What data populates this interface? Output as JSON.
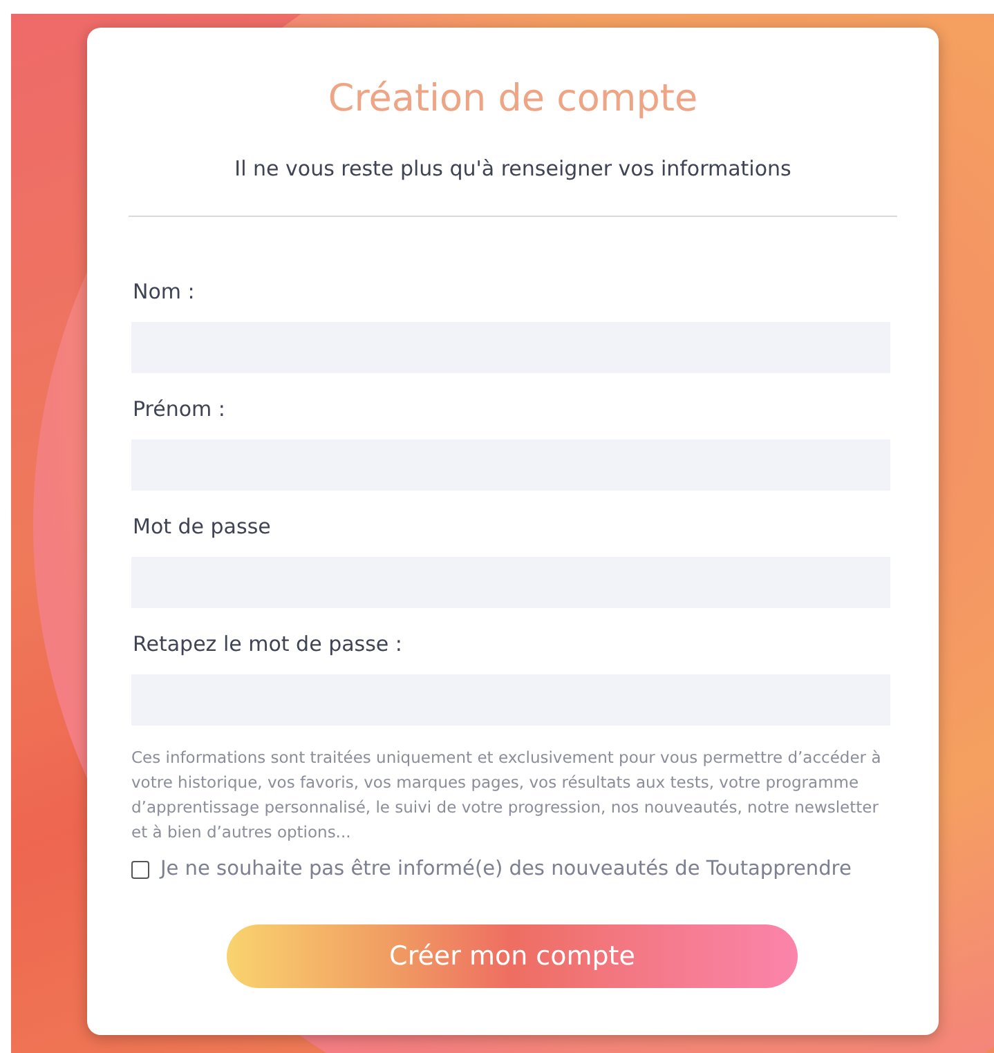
{
  "title": "Création de compte",
  "subtitle": "Il ne vous reste plus qu'à renseigner vos informations",
  "fields": [
    {
      "label": "Nom :"
    },
    {
      "label": "Prénom :"
    },
    {
      "label": "Mot de passe"
    },
    {
      "label": "Retapez le mot de passe :"
    }
  ],
  "notice": "Ces informations sont traitées uniquement et exclusivement pour vous permettre d’accéder à votre historique, vos favoris, vos marques pages, vos résultats aux tests, votre programme d’apprentissage personnalisé, le suivi de votre progression, nos nouveautés, notre newsletter et à bien d’autres options...",
  "opt_out": {
    "label": "Je ne souhaite pas être informé(e) des nouveautés de Toutapprendre",
    "checked": false
  },
  "submit": "Créer mon compte"
}
